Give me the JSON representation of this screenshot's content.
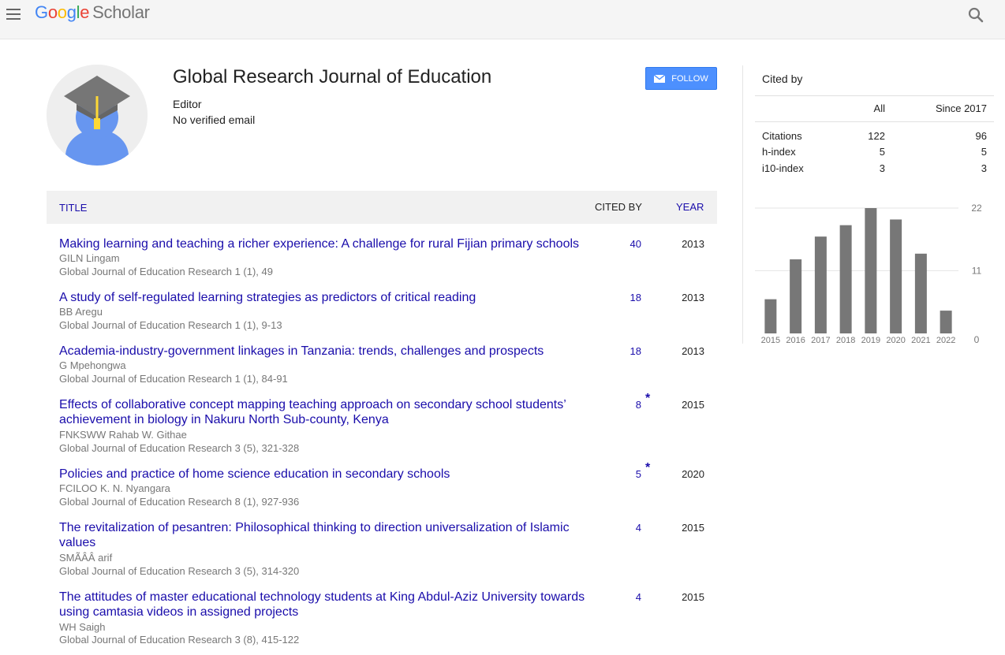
{
  "topbar": {
    "logo_letters": [
      "G",
      "o",
      "o",
      "g",
      "l",
      "e"
    ],
    "logo_product": "Scholar",
    "icons": {
      "menu": "hamburger-menu-icon",
      "search": "search-icon"
    }
  },
  "profile": {
    "name": "Global Research Journal of Education",
    "affiliation": "Editor",
    "email": "No verified email",
    "follow_label": "FOLLOW",
    "avatar_icon": "graduation-cap-avatar-icon"
  },
  "articles": {
    "headers": {
      "title": "TITLE",
      "cited_by": "CITED BY",
      "year": "YEAR"
    },
    "rows": [
      {
        "title": "Making learning and teaching a richer experience: A challenge for rural Fijian primary schools",
        "authors": "GILN Lingam",
        "publication": "Global Journal of Education Research 1 (1), 49",
        "cited_by": "40",
        "star": "",
        "year": "2013"
      },
      {
        "title": "A study of self-regulated learning strategies as predictors of critical reading",
        "authors": "BB Aregu",
        "publication": "Global Journal of Education Research 1 (1), 9-13",
        "cited_by": "18",
        "star": "",
        "year": "2013"
      },
      {
        "title": "Academia-industry-government linkages in Tanzania: trends, challenges and prospects",
        "authors": "G Mpehongwa",
        "publication": "Global Journal of Education Research 1 (1), 84-91",
        "cited_by": "18",
        "star": "",
        "year": "2013"
      },
      {
        "title": "Effects of collaborative concept mapping teaching approach on secondary school students’ achievement in biology in Nakuru North Sub-county, Kenya",
        "authors": "FNKSWW Rahab W. Githae",
        "publication": "Global Journal of Education Research 3 (5), 321-328",
        "cited_by": "8",
        "star": "*",
        "year": "2015"
      },
      {
        "title": "Policies and practice of home science education in secondary schools",
        "authors": "FCILOO K. N. Nyangara",
        "publication": "Global Journal of Education Research 8 (1), 927-936",
        "cited_by": "5",
        "star": "*",
        "year": "2020"
      },
      {
        "title": "The revitalization of pesantren: Philosophical thinking to direction universalization of Islamic values",
        "authors": "SMÃÂÂ arif",
        "publication": "Global Journal of Education Research 3 (5), 314-320",
        "cited_by": "4",
        "star": "",
        "year": "2015"
      },
      {
        "title": "The attitudes of master educational technology students at King Abdul-Aziz University towards using camtasia videos in assigned projects",
        "authors": "WH Saigh",
        "publication": "Global Journal of Education Research 3 (8), 415-122",
        "cited_by": "4",
        "star": "",
        "year": "2015"
      }
    ]
  },
  "cited_by": {
    "title": "Cited by",
    "columns": [
      "All",
      "Since 2017"
    ],
    "metrics": [
      {
        "label": "Citations",
        "all": "122",
        "since": "96"
      },
      {
        "label": "h-index",
        "all": "5",
        "since": "5"
      },
      {
        "label": "i10-index",
        "all": "3",
        "since": "3"
      }
    ]
  },
  "chart_data": {
    "type": "bar",
    "categories": [
      "2015",
      "2016",
      "2017",
      "2018",
      "2019",
      "2020",
      "2021",
      "2022"
    ],
    "values": [
      6,
      13,
      17,
      19,
      22,
      20,
      14,
      4
    ],
    "yticks": [
      "0",
      "11",
      "22"
    ],
    "ylim": [
      0,
      22
    ],
    "grid": true,
    "bar_color": "#777777",
    "title": "",
    "xlabel": "",
    "ylabel": ""
  }
}
